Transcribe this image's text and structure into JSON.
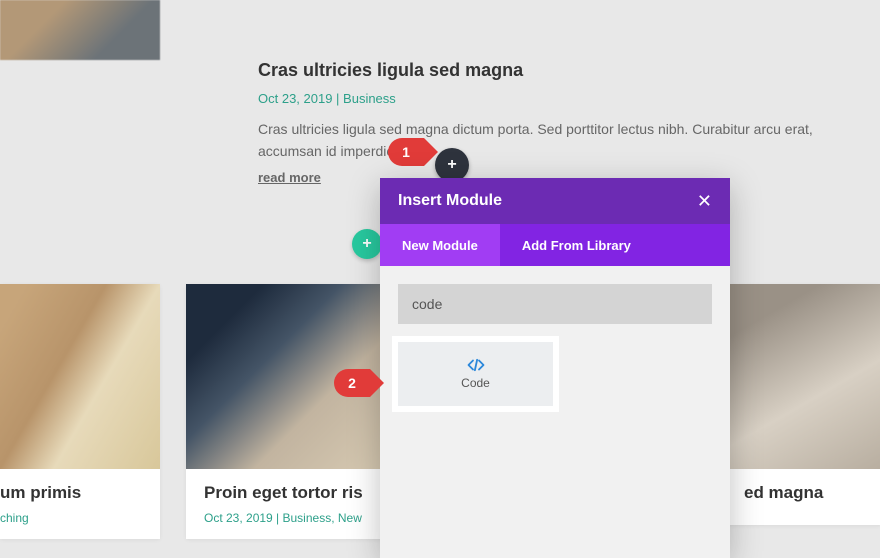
{
  "hero": {
    "title": "Cras ultricies ligula sed magna",
    "meta": "Oct 23, 2019 | Business",
    "excerpt": "Cras ultricies ligula sed magna dictum porta. Sed porttitor lectus nibh. Curabitur arcu erat, accumsan id imperdiet...",
    "read_more": "read more"
  },
  "cards": {
    "c1": {
      "title": "um primis",
      "meta": "ching"
    },
    "c2": {
      "title": "Proin eget tortor ris",
      "meta": "Oct 23, 2019 | Business, New"
    },
    "c3": {
      "title": "ed magna",
      "meta": ""
    }
  },
  "badges": {
    "b1": "1",
    "b2": "2"
  },
  "fab": {
    "plus": "+",
    "plus2": "+"
  },
  "modal": {
    "title": "Insert Module",
    "close": "✕",
    "tab_new": "New Module",
    "tab_lib": "Add From Library",
    "search_value": "code",
    "module": {
      "label": "Code"
    }
  }
}
